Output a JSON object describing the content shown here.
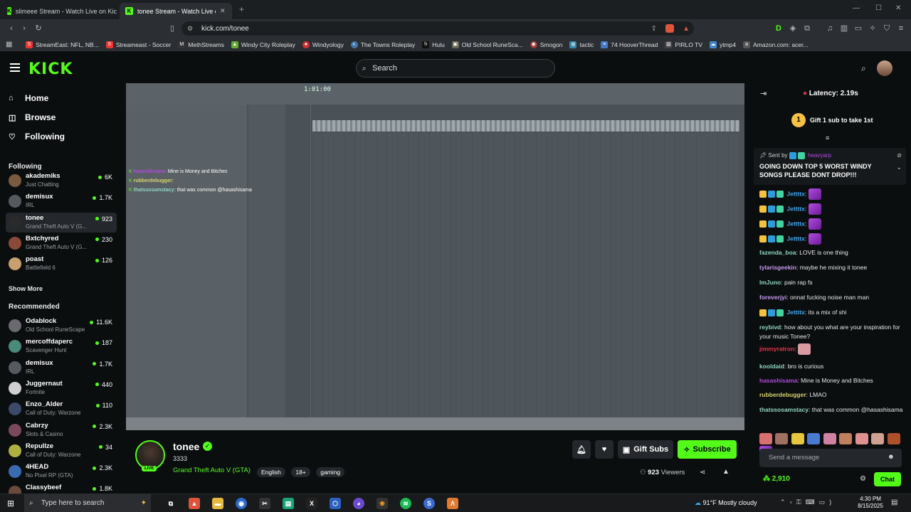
{
  "browser": {
    "tabs": [
      {
        "title": "slimeee Stream - Watch Live on Kick",
        "active": false
      },
      {
        "title": "tonee Stream - Watch Live on Kick",
        "active": true
      }
    ],
    "url": "kick.com/tonee",
    "bookmarks": [
      "StreamEast: NFL, NB...",
      "Streameast - Soccer",
      "MethStreams",
      "Windy City Roleplay",
      "Windyology",
      "The Towns Roleplay",
      "Hulu",
      "Old School RuneSca...",
      "Smogon",
      "tactic",
      "74 HooverThread",
      "PIRLO TV",
      "ytmp4",
      "Amazon.com: acer..."
    ]
  },
  "header": {
    "logo": "KICK",
    "search_placeholder": "Search"
  },
  "sidebar": {
    "nav": [
      {
        "label": "Home",
        "icon": "home-icon"
      },
      {
        "label": "Browse",
        "icon": "compass-icon"
      },
      {
        "label": "Following",
        "icon": "heart-icon"
      }
    ],
    "following_title": "Following",
    "following": [
      {
        "name": "akademiks",
        "category": "Just Chatting",
        "viewers": "6K",
        "color": "#7a5a40"
      },
      {
        "name": "demisux",
        "category": "IRL",
        "viewers": "1.7K",
        "color": "#555a60"
      },
      {
        "name": "tonee",
        "category": "Grand Theft Auto V (G...",
        "viewers": "923",
        "color": "#2a2a2a"
      },
      {
        "name": "Bxtchyred",
        "category": "Grand Theft Auto V (G...",
        "viewers": "230",
        "color": "#8a4a3a"
      },
      {
        "name": "poast",
        "category": "Battlefield 6",
        "viewers": "126",
        "color": "#c8a070"
      }
    ],
    "show_more": "Show More",
    "recommended_title": "Recommended",
    "recommended": [
      {
        "name": "Odablock",
        "category": "Old School RuneScape",
        "viewers": "11.6K",
        "color": "#6a6a70"
      },
      {
        "name": "mercoffdaperc",
        "category": "Scavenger Hunt",
        "viewers": "187",
        "color": "#4a8a7a"
      },
      {
        "name": "demisux",
        "category": "IRL",
        "viewers": "1.7K",
        "color": "#555a60"
      },
      {
        "name": "Juggernaut",
        "category": "Fortnite",
        "viewers": "440",
        "color": "#d0d0d0"
      },
      {
        "name": "Enzo_Alder",
        "category": "Call of Duty: Warzone",
        "viewers": "110",
        "color": "#3a4a6a"
      },
      {
        "name": "Cabrzy",
        "category": "Slots & Casino",
        "viewers": "2.3K",
        "color": "#7a4a5a"
      },
      {
        "name": "Repullze",
        "category": "Call of Duty: Warzone",
        "viewers": "34",
        "color": "#b0b040"
      },
      {
        "name": "4HEAD",
        "category": "No Pixel RP (GTA)",
        "viewers": "2.3K",
        "color": "#3a6ab0"
      },
      {
        "name": "Classybeef",
        "category": "",
        "viewers": "1.8K",
        "color": "#6a4a3a"
      }
    ]
  },
  "video_overlay_chat": [
    {
      "user": "",
      "text": "Mine is Money and Bitches",
      "color": "#b04adf"
    },
    {
      "user": "rubberdebugger:",
      "text": "",
      "color": "#d6d36b"
    },
    {
      "user": "thatssosamstacy:",
      "text": "that was common @hasashisama",
      "color": "#8fd4c2"
    }
  ],
  "streamer": {
    "name": "tonee",
    "followers": "3333",
    "live_badge": "LIVE",
    "category": "Grand Theft Auto V (GTA)",
    "tags": [
      "English",
      "18+",
      "gaming"
    ],
    "viewers_count": "923",
    "viewers_label": "Viewers",
    "gift_subs": "Gift Subs",
    "subscribe": "Subscribe"
  },
  "chat": {
    "latency": "Latency: 2.19s",
    "gift_banner": "Gift 1 sub to take 1st",
    "gift_rank": "1",
    "pinned_sent_by": "Sent by",
    "pinned_user": "heavyarp",
    "pinned_text": "GOING DOWN TOP 5 WORST WINDY SONGS PLEASE DONT DROP!!!",
    "messages": [
      {
        "user": "Jettttx",
        "text": "",
        "color": "#3fa7f0",
        "emote": true,
        "badges": true
      },
      {
        "user": "Jettttx",
        "text": "",
        "color": "#3fa7f0",
        "emote": true,
        "badges": true
      },
      {
        "user": "Jettttx",
        "text": "",
        "color": "#3fa7f0",
        "emote": true,
        "badges": true
      },
      {
        "user": "Jettttx",
        "text": "",
        "color": "#3fa7f0",
        "emote": true,
        "badges": true
      },
      {
        "user": "fazenda_boa",
        "text": "LOVE is one thing",
        "color": "#8fd4c2"
      },
      {
        "user": "tylarisgeekin",
        "text": "maybe he mixing it tonee",
        "color": "#c59aef"
      },
      {
        "user": "lmJuno",
        "text": "pain rap fs",
        "color": "#8fd4c2"
      },
      {
        "user": "foreverjyi",
        "text": "onnat fucking noise man man",
        "color": "#c59aef"
      },
      {
        "user": "Jettttx",
        "text": "its a mix of shi",
        "color": "#3fa7f0",
        "badges": true
      },
      {
        "user": "reybivd",
        "text": "how about you what are your inspiration for your music Tonee?",
        "color": "#8fd4c2"
      },
      {
        "user": "jimmyratron",
        "text": "",
        "color": "#e5344b",
        "pink_emote": true
      },
      {
        "user": "kooldaid",
        "text": "bro is curious",
        "color": "#8fd4c2"
      },
      {
        "user": "hasashisama",
        "text": "Mine is Money and Bitches",
        "color": "#b04adf"
      },
      {
        "user": "rubberdebugger",
        "text": "LMAO",
        "color": "#d6d36b"
      },
      {
        "user": "thatssosamstacy",
        "text": "that was common @hasashisama",
        "color": "#8fd4c2"
      }
    ],
    "input_placeholder": "Send a message",
    "points": "2,910",
    "chat_button": "Chat"
  },
  "taskbar": {
    "search_placeholder": "Type here to search",
    "weather": "91°F  Mostly cloudy",
    "time": "4:30 PM",
    "date": "8/15/2025"
  },
  "colors": {
    "kick_green": "#53fc18",
    "bg": "#0b0e0f",
    "panel": "#24272b"
  }
}
